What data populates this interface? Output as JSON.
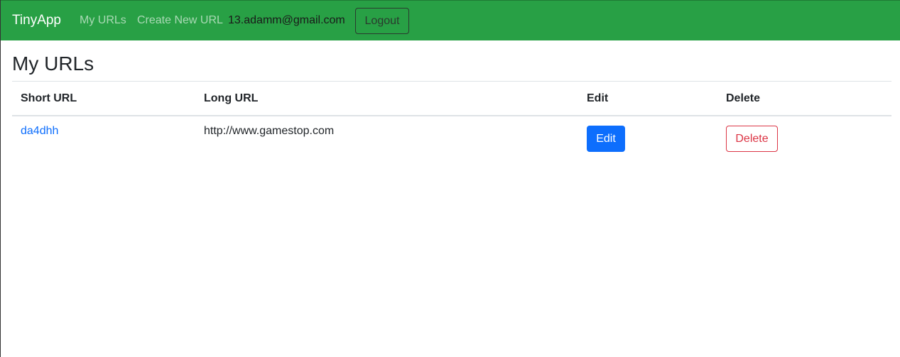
{
  "navbar": {
    "brand": "TinyApp",
    "links": [
      "My URLs",
      "Create New URL"
    ],
    "user_email": "13.adamm@gmail.com",
    "logout_label": "Logout",
    "color": "#28a045"
  },
  "main": {
    "title": "My URLs",
    "table": {
      "headers": [
        "Short URL",
        "Long URL",
        "Edit",
        "Delete"
      ],
      "rows": [
        {
          "short_url": "da4dhh",
          "long_url": "http://www.gamestop.com",
          "edit_label": "Edit",
          "delete_label": "Delete"
        }
      ]
    }
  },
  "colors": {
    "link": "#0d6efd",
    "edit_button": "#0d6efd",
    "delete_button": "#dc3545"
  }
}
